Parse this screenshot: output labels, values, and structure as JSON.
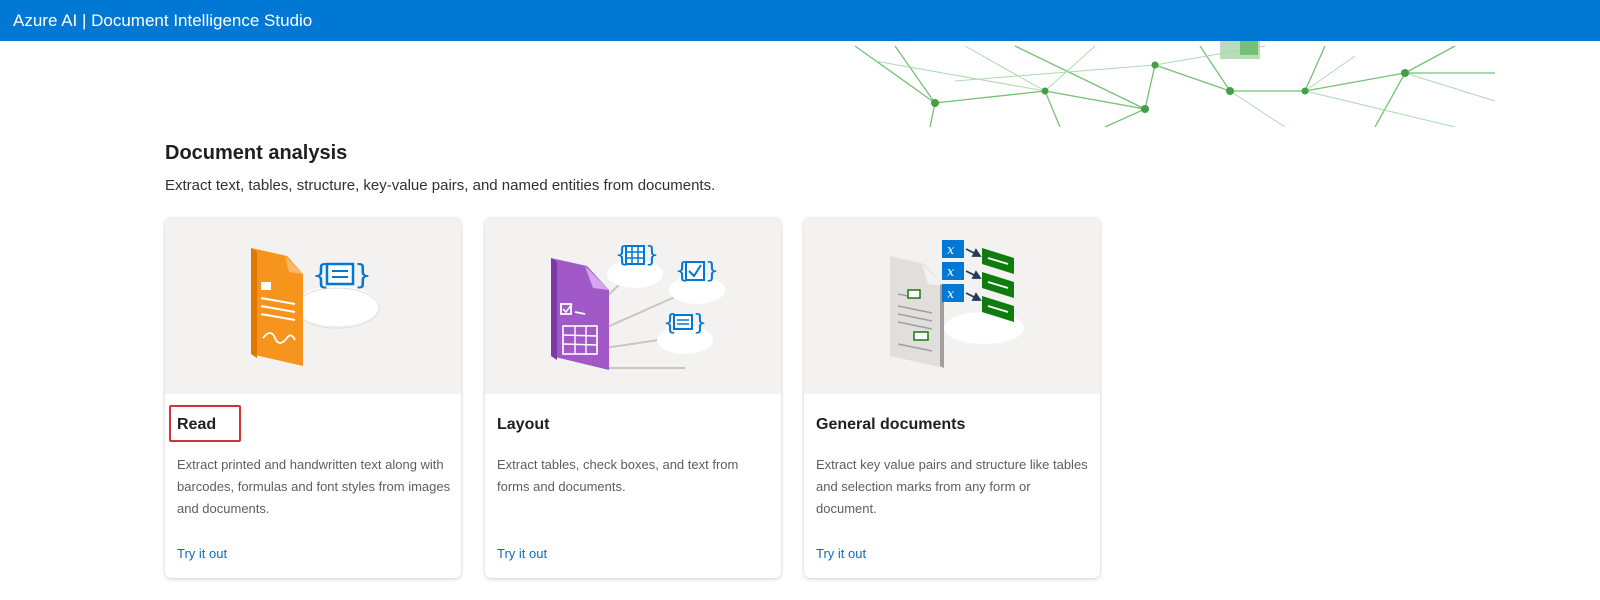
{
  "app": {
    "title": "Azure AI | Document Intelligence Studio"
  },
  "section": {
    "title": "Document analysis",
    "description": "Extract text, tables, structure, key-value pairs, and named entities from documents."
  },
  "cards": [
    {
      "title": "Read",
      "description": "Extract printed and handwritten text along with barcodes, formulas and font styles from images and documents.",
      "link": "Try it out",
      "icon": "read-document-icon"
    },
    {
      "title": "Layout",
      "description": "Extract tables, check boxes, and text from forms and documents.",
      "link": "Try it out",
      "icon": "layout-document-icon"
    },
    {
      "title": "General documents",
      "description": "Extract key value pairs and structure like tables and selection marks from any form or document.",
      "link": "Try it out",
      "icon": "general-document-icon"
    }
  ],
  "colors": {
    "header": "#0078d4",
    "link": "#0f6cbd",
    "highlight": "#d13438",
    "network": "#4caf50"
  }
}
